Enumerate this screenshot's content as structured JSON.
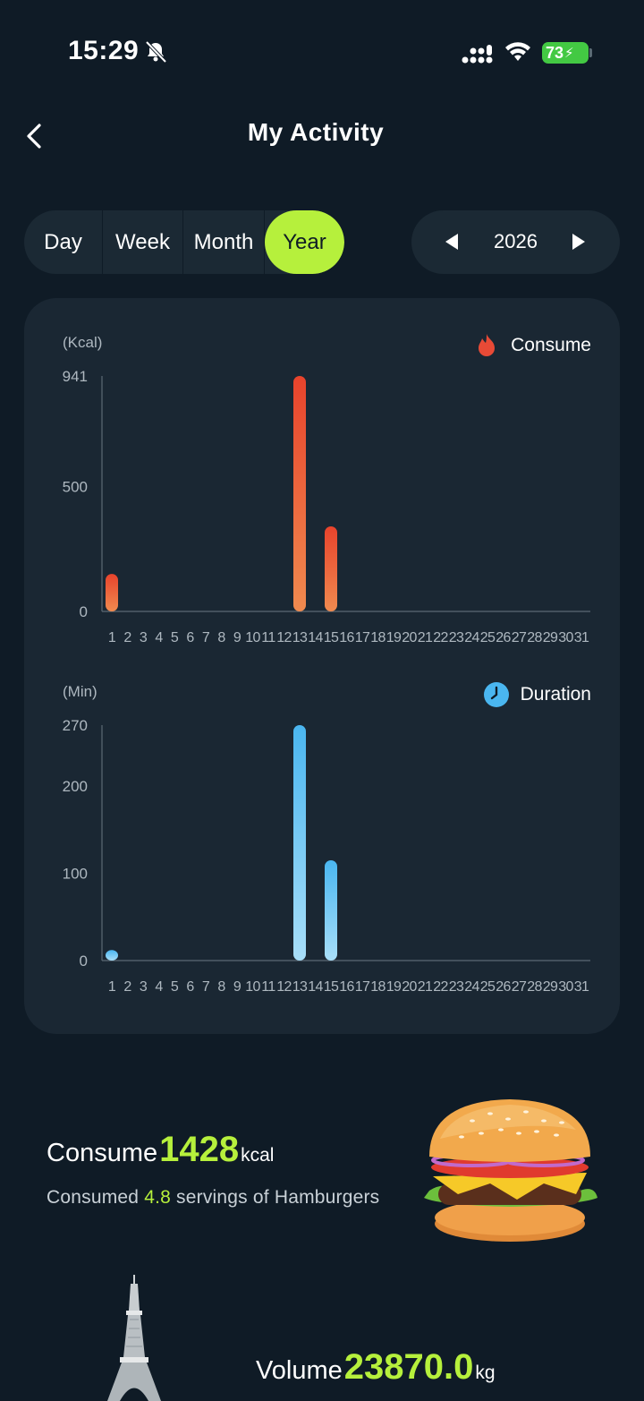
{
  "status_bar": {
    "time": "15:29",
    "battery": "73"
  },
  "header": {
    "title": "My Activity"
  },
  "period_tabs": [
    "Day",
    "Week",
    "Month",
    "Year"
  ],
  "selected_period": "Year",
  "year_nav": {
    "year": "2026"
  },
  "colors": {
    "accent": "#b6f03c",
    "consume_top": "#e8432c",
    "consume_bottom": "#f08a4f",
    "duration_top": "#4ab6f0",
    "duration_bottom": "#a8def8",
    "background": "#0f1b26",
    "card": "#1a2733"
  },
  "chart_data": [
    {
      "type": "bar",
      "unit_label": "(Kcal)",
      "legend": "Consume",
      "legend_icon": "flame-icon",
      "categories": [
        "1",
        "2",
        "3",
        "4",
        "5",
        "6",
        "7",
        "8",
        "9",
        "10",
        "11",
        "12",
        "13",
        "14",
        "15",
        "16",
        "17",
        "18",
        "19",
        "20",
        "21",
        "22",
        "23",
        "24",
        "25",
        "26",
        "27",
        "28",
        "29",
        "30",
        "31"
      ],
      "values": [
        150,
        0,
        0,
        0,
        0,
        0,
        0,
        0,
        0,
        0,
        0,
        0,
        941,
        0,
        340,
        0,
        0,
        0,
        0,
        0,
        0,
        0,
        0,
        0,
        0,
        0,
        0,
        0,
        0,
        0,
        0
      ],
      "yticks": [
        "941",
        "500",
        "0"
      ],
      "ytick_values": [
        941,
        500,
        0
      ],
      "ylim": [
        0,
        941
      ]
    },
    {
      "type": "bar",
      "unit_label": "(Min)",
      "legend": "Duration",
      "legend_icon": "clock-icon",
      "categories": [
        "1",
        "2",
        "3",
        "4",
        "5",
        "6",
        "7",
        "8",
        "9",
        "10",
        "11",
        "12",
        "13",
        "14",
        "15",
        "16",
        "17",
        "18",
        "19",
        "20",
        "21",
        "22",
        "23",
        "24",
        "25",
        "26",
        "27",
        "28",
        "29",
        "30",
        "31"
      ],
      "values": [
        12,
        0,
        0,
        0,
        0,
        0,
        0,
        0,
        0,
        0,
        0,
        0,
        270,
        0,
        115,
        0,
        0,
        0,
        0,
        0,
        0,
        0,
        0,
        0,
        0,
        0,
        0,
        0,
        0,
        0,
        0
      ],
      "yticks": [
        "270",
        "200",
        "100",
        "0"
      ],
      "ytick_values": [
        270,
        200,
        100,
        0
      ],
      "ylim": [
        0,
        270
      ]
    }
  ],
  "consume_summary": {
    "label": "Consume",
    "value": "1428",
    "unit": "kcal",
    "servings_prefix": "Consumed",
    "servings_value": "4.8",
    "servings_suffix": "servings of Hamburgers",
    "image": "hamburger-image"
  },
  "volume_summary": {
    "label": "Volume",
    "value": "23870.0",
    "unit": "kg",
    "image": "eiffel-tower-image"
  }
}
